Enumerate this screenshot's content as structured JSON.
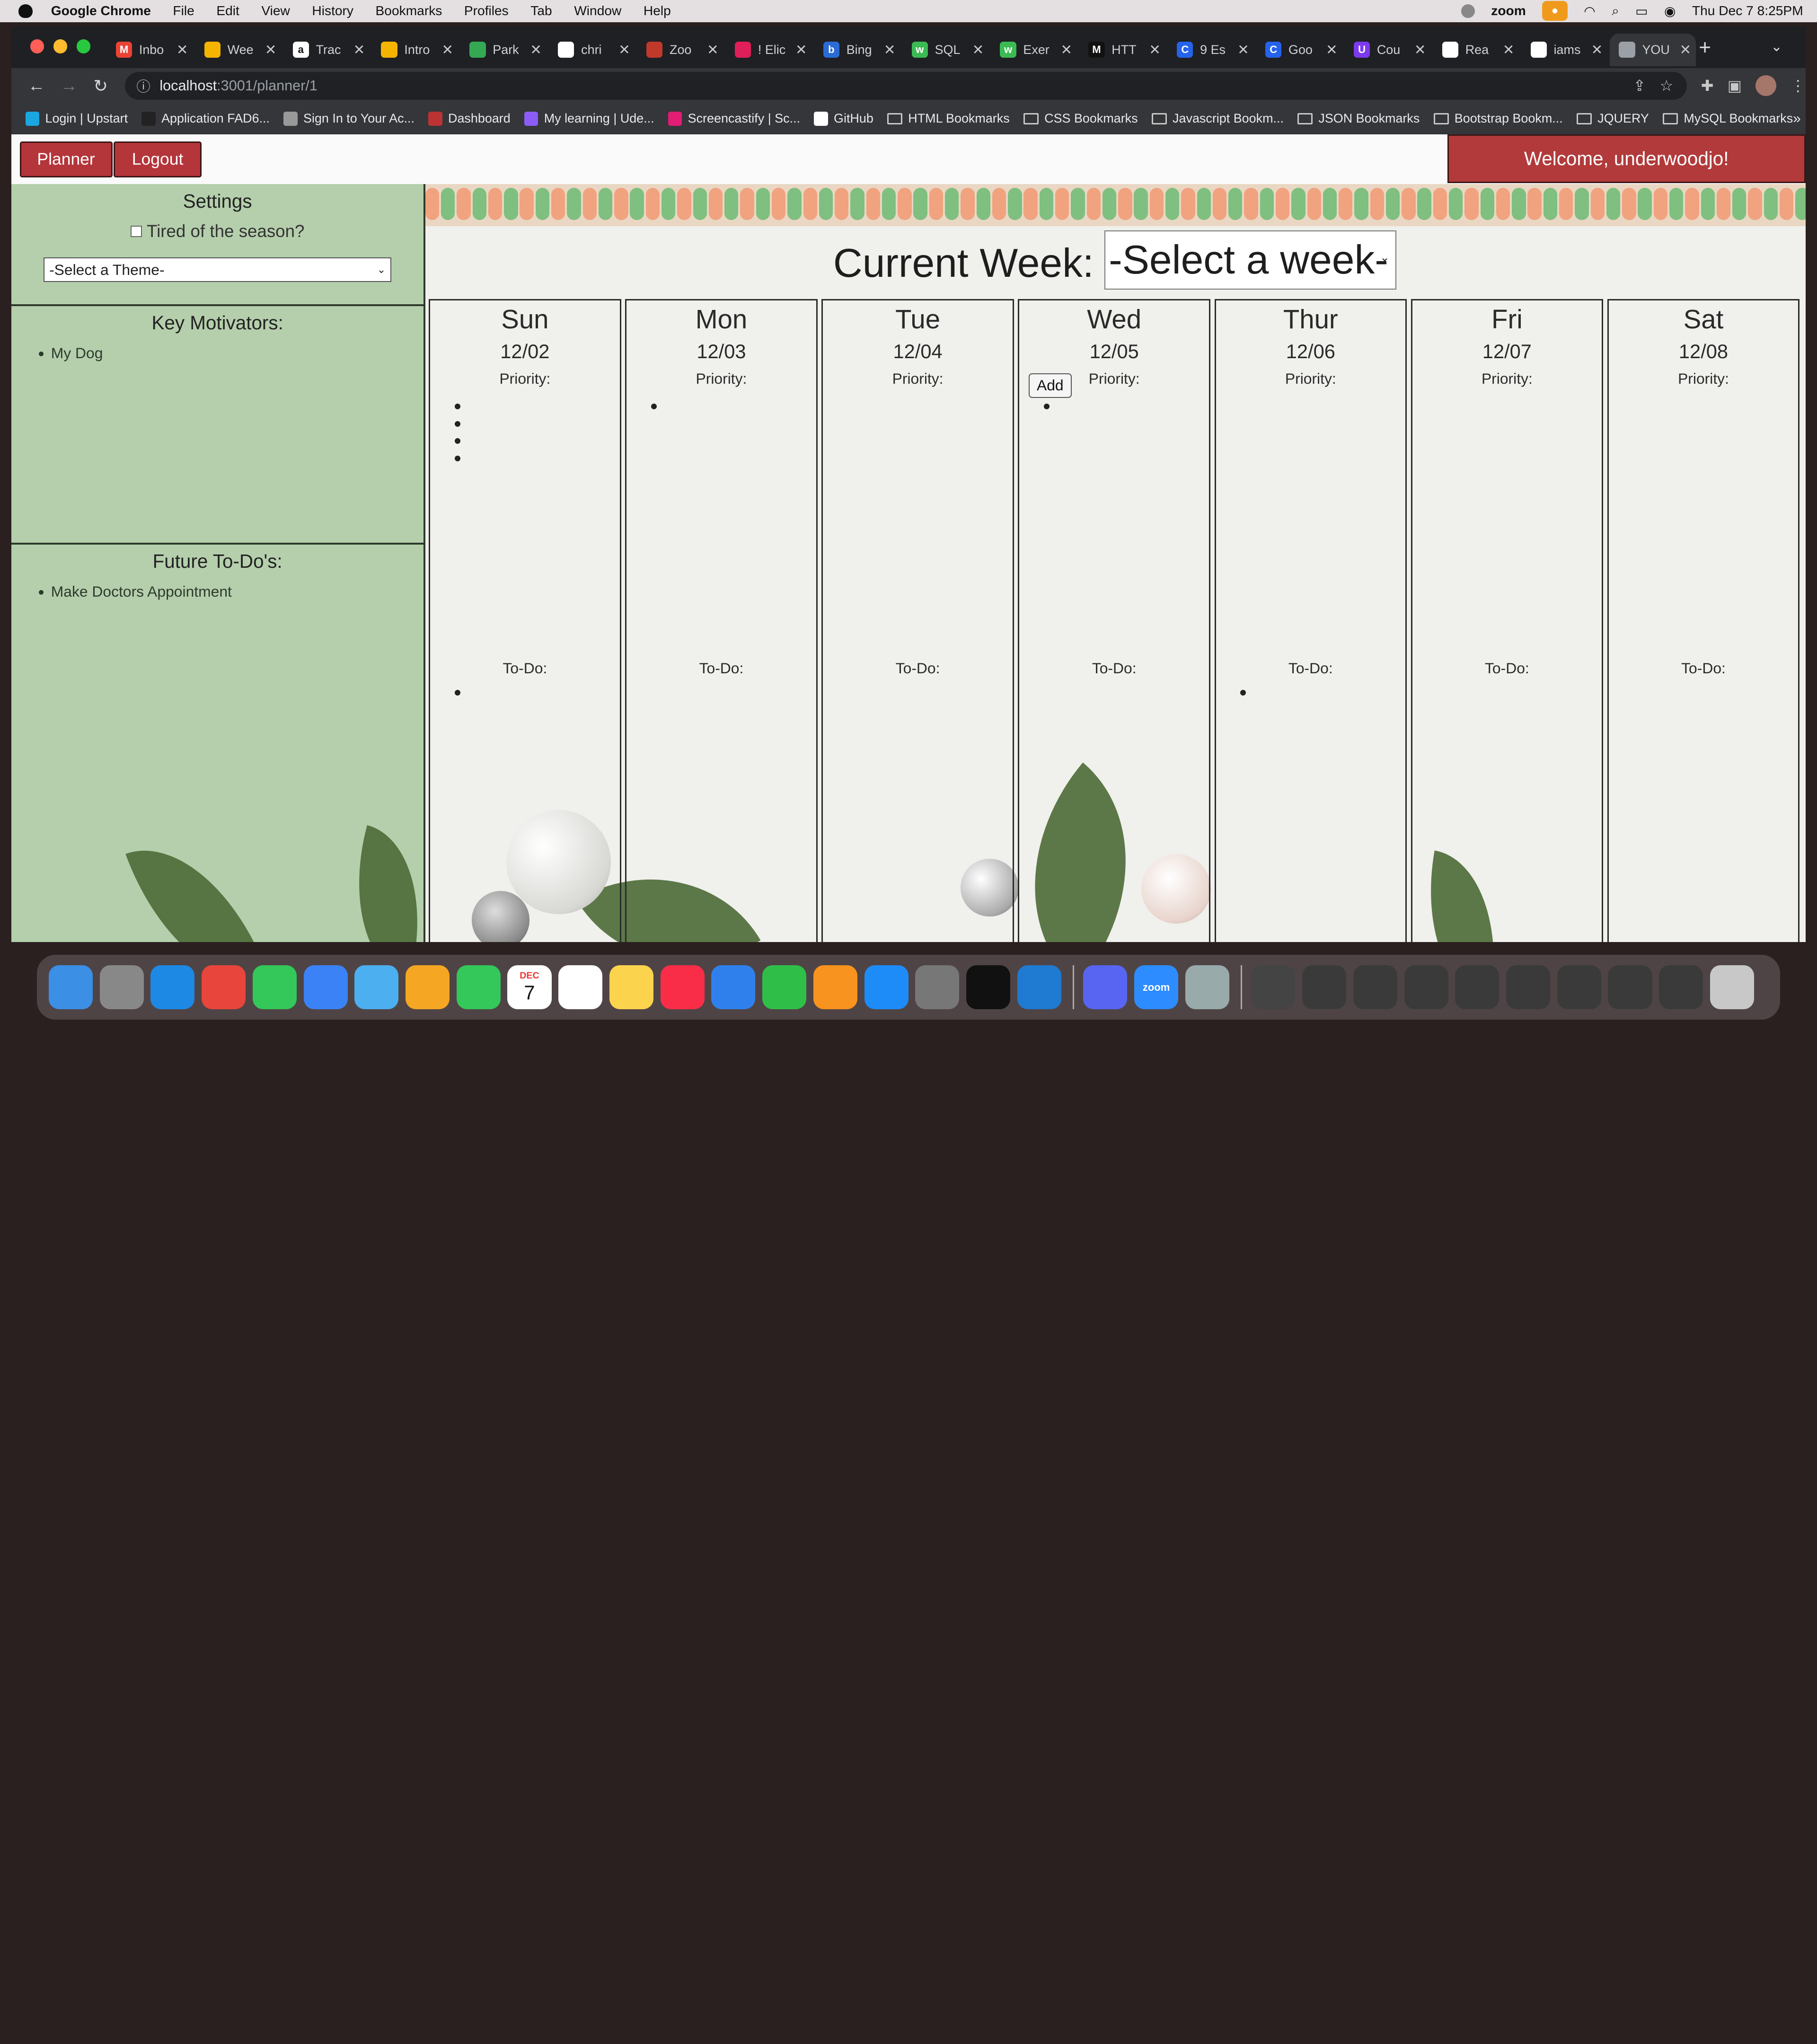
{
  "menubar": {
    "app": "Google Chrome",
    "items": [
      "File",
      "Edit",
      "View",
      "History",
      "Bookmarks",
      "Profiles",
      "Tab",
      "Window",
      "Help"
    ],
    "zoom_label": "zoom",
    "datetime": "Thu Dec 7  8:25PM"
  },
  "tabs": [
    {
      "label": "Inbo",
      "color": "#ea4335",
      "glyph": "M"
    },
    {
      "label": "Wee",
      "color": "#f4b400",
      "glyph": ""
    },
    {
      "label": "Trac",
      "color": "#ffffff",
      "glyph": "a"
    },
    {
      "label": "Intro",
      "color": "#f4b400",
      "glyph": ""
    },
    {
      "label": "Park",
      "color": "#34a853",
      "glyph": ""
    },
    {
      "label": "chri",
      "color": "#ffffff",
      "glyph": ""
    },
    {
      "label": "Zoo",
      "color": "#c0392b",
      "glyph": ""
    },
    {
      "label": "! Elic",
      "color": "#e01e5a",
      "glyph": ""
    },
    {
      "label": "Bing",
      "color": "#2b6bd6",
      "glyph": "b"
    },
    {
      "label": "SQL",
      "color": "#3cba54",
      "glyph": "w"
    },
    {
      "label": "Exer",
      "color": "#3cba54",
      "glyph": "w"
    },
    {
      "label": "HTT",
      "color": "#111111",
      "glyph": "M"
    },
    {
      "label": "9 Es",
      "color": "#2563eb",
      "glyph": "C"
    },
    {
      "label": "Goo",
      "color": "#2563eb",
      "glyph": "C"
    },
    {
      "label": "Cou",
      "color": "#7c3aed",
      "glyph": "U"
    },
    {
      "label": "Rea",
      "color": "#ffffff",
      "glyph": ""
    },
    {
      "label": "iams",
      "color": "#ffffff",
      "glyph": ""
    },
    {
      "label": "YOU",
      "color": "#9aa0a6",
      "glyph": ""
    }
  ],
  "address": {
    "host": "localhost",
    "path": ":3001/planner/1"
  },
  "bookmarks": [
    {
      "label": "Login | Upstart",
      "kind": "site",
      "color": "#1aa6e0"
    },
    {
      "label": "Application FAD6...",
      "kind": "site",
      "color": "#222"
    },
    {
      "label": "Sign In to Your Ac...",
      "kind": "site",
      "color": "#999"
    },
    {
      "label": "Dashboard",
      "kind": "site",
      "color": "#b33"
    },
    {
      "label": "My learning | Ude...",
      "kind": "site",
      "color": "#8b5cf6"
    },
    {
      "label": "Screencastify | Sc...",
      "kind": "site",
      "color": "#e11d74"
    },
    {
      "label": "GitHub",
      "kind": "site",
      "color": "#fff"
    },
    {
      "label": "HTML Bookmarks",
      "kind": "folder"
    },
    {
      "label": "CSS Bookmarks",
      "kind": "folder"
    },
    {
      "label": "Javascript Bookm...",
      "kind": "folder"
    },
    {
      "label": "JSON Bookmarks",
      "kind": "folder"
    },
    {
      "label": "Bootstrap Bookm...",
      "kind": "folder"
    },
    {
      "label": "JQUERY",
      "kind": "folder"
    },
    {
      "label": "MySQL Bookmarks",
      "kind": "folder"
    }
  ],
  "nav": {
    "planner": "Planner",
    "logout": "Logout",
    "welcome": "Welcome, underwoodjo!"
  },
  "settings": {
    "title": "Settings",
    "season_label": "Tired of the season?",
    "theme_placeholder": "-Select a Theme-"
  },
  "motivators": {
    "title": "Key Motivators:",
    "items": [
      "My Dog"
    ]
  },
  "future": {
    "title": "Future To-Do's:",
    "items": [
      "Make Doctors Appointment"
    ]
  },
  "planner": {
    "current_week_label": "Current Week:",
    "week_select": "-Select a week-",
    "priority_label": "Priority:",
    "todo_label": "To-Do:",
    "add_label": "Add",
    "days": [
      {
        "name": "Sun",
        "date": "12/02",
        "priority_bullets": 4,
        "todo_bullets": 1
      },
      {
        "name": "Mon",
        "date": "12/03",
        "priority_bullets": 1,
        "todo_bullets": 0
      },
      {
        "name": "Tue",
        "date": "12/04",
        "priority_bullets": 0,
        "todo_bullets": 0
      },
      {
        "name": "Wed",
        "date": "12/05",
        "priority_bullets": 1,
        "todo_bullets": 0
      },
      {
        "name": "Thur",
        "date": "12/06",
        "priority_bullets": 0,
        "todo_bullets": 1
      },
      {
        "name": "Fri",
        "date": "12/07",
        "priority_bullets": 0,
        "todo_bullets": 0
      },
      {
        "name": "Sat",
        "date": "12/08",
        "priority_bullets": 0,
        "todo_bullets": 0
      }
    ]
  },
  "dock": [
    {
      "name": "finder-icon",
      "color": "#3b8fe5"
    },
    {
      "name": "launchpad-icon",
      "color": "#888"
    },
    {
      "name": "safari-icon",
      "color": "#1e88e5"
    },
    {
      "name": "chrome-icon",
      "color": "#e8453c"
    },
    {
      "name": "messages-icon",
      "color": "#34c759"
    },
    {
      "name": "mail-icon",
      "color": "#3b82f6"
    },
    {
      "name": "maps-icon",
      "color": "#4cafef"
    },
    {
      "name": "photos-icon",
      "color": "#f5a623"
    },
    {
      "name": "facetime-icon",
      "color": "#34c759"
    },
    {
      "name": "calendar-icon",
      "color": "#ffffff"
    },
    {
      "name": "reminders-icon",
      "color": "#ffffff"
    },
    {
      "name": "notes-icon",
      "color": "#fcd34d"
    },
    {
      "name": "music-icon",
      "color": "#fa2d48"
    },
    {
      "name": "keynote-icon",
      "color": "#2f80ed"
    },
    {
      "name": "numbers-icon",
      "color": "#2fbf49"
    },
    {
      "name": "pages-icon",
      "color": "#f7931e"
    },
    {
      "name": "app-store-icon",
      "color": "#1d8cf8"
    },
    {
      "name": "system-settings-icon",
      "color": "#777"
    },
    {
      "name": "terminal-icon",
      "color": "#111"
    },
    {
      "name": "vscode-icon",
      "color": "#1f7ad1"
    },
    {
      "name": "discord-icon",
      "color": "#5865f2"
    },
    {
      "name": "zoom-icon",
      "color": "#2d8cff"
    },
    {
      "name": "preview-icon",
      "color": "#9aa"
    },
    {
      "name": "screenshot-thumb-icon",
      "color": "#444"
    }
  ],
  "dock_calendar": {
    "month": "DEC",
    "day": "7"
  },
  "dock_zoom_label": "zoom"
}
